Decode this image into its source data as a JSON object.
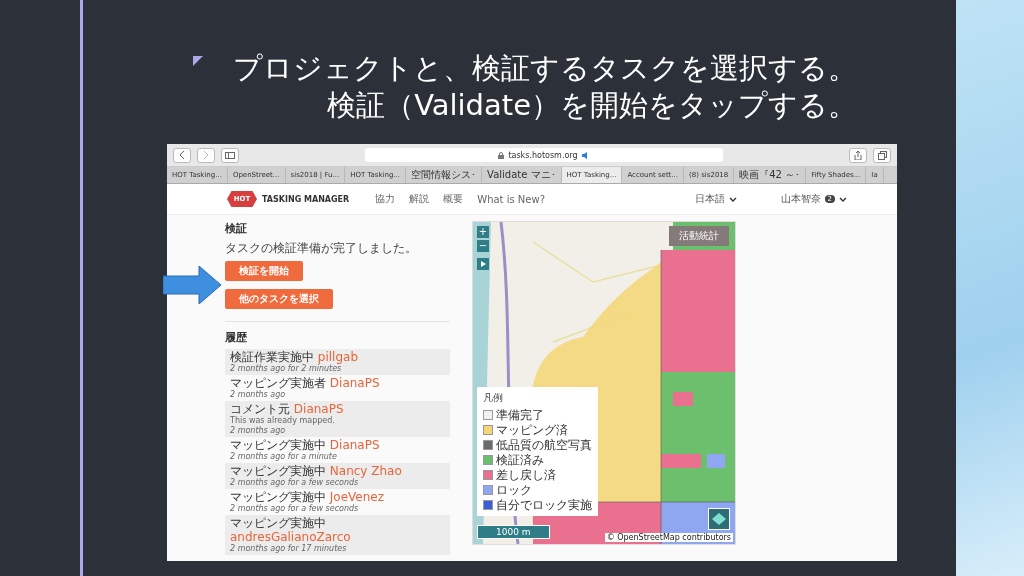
{
  "slide": {
    "title_lines": [
      "プロジェクトと、検証するタスクを選択する。",
      "検証（Validate）を開始をタップする。"
    ]
  },
  "browser": {
    "address": "tasks.hotosm.org",
    "tabs": [
      {
        "label": "HOT Tasking...",
        "selected": false
      },
      {
        "label": "OpenStreet...",
        "selected": false
      },
      {
        "label": "sis2018 | Fu...",
        "selected": false
      },
      {
        "label": "HOT Tasking...",
        "selected": false
      },
      {
        "label": "空間情報シス･",
        "selected": false
      },
      {
        "label": "Validate マニ･",
        "selected": false
      },
      {
        "label": "HOT Tasking...",
        "selected": true
      },
      {
        "label": "Account sett...",
        "selected": false
      },
      {
        "label": "(8) sis2018",
        "selected": false
      },
      {
        "label": "映画『42 ～･",
        "selected": false
      },
      {
        "label": "Fifty Shades...",
        "selected": false
      },
      {
        "label": "Ia",
        "selected": false
      }
    ]
  },
  "site_header": {
    "logo_text": "HOT",
    "brand": "TASKING MANAGER",
    "nav": [
      "協力",
      "解説",
      "概要",
      "What is New?"
    ],
    "language": "日本語",
    "user": "山本智奈",
    "user_badge": "2"
  },
  "task_panel": {
    "heading": "検証",
    "message": "タスクの検証準備が完了しました。",
    "buttons": [
      "検証を開始",
      "他のタスクを選択"
    ]
  },
  "history": {
    "heading": "履歴",
    "entries": [
      {
        "action": "検証作業実施中",
        "user": "pillgab",
        "time": "2 months ago for 2 minutes"
      },
      {
        "action": "マッピング実施者",
        "user": "DianaPS",
        "time": "2 months ago"
      },
      {
        "action": "コメント元",
        "user": "DianaPS",
        "comment": "This was already mapped.",
        "time": "2 months ago"
      },
      {
        "action": "マッピング実施中",
        "user": "DianaPS",
        "time": "2 months ago for a minute"
      },
      {
        "action": "マッピング実施中",
        "user": "Nancy Zhao",
        "time": "2 months ago for a few seconds"
      },
      {
        "action": "マッピング実施中",
        "user": "JoeVenez",
        "time": "2 months ago for a few seconds"
      },
      {
        "action": "マッピング実施中",
        "user": "andresGalianoZarco",
        "time": "2 months ago for 17 minutes"
      }
    ]
  },
  "map": {
    "stats_button": "活動統計",
    "zoom_in": "+",
    "zoom_out": "−",
    "legend": {
      "title": "凡例",
      "items": [
        {
          "label": "準備完了",
          "color": "#eef2f4"
        },
        {
          "label": "マッピング済",
          "color": "#f5d77a"
        },
        {
          "label": "低品質の航空写真",
          "color": "#6b6b6b"
        },
        {
          "label": "検証済み",
          "color": "#6cbf6c"
        },
        {
          "label": "差し戻し済",
          "color": "#e9708e"
        },
        {
          "label": "ロック",
          "color": "#8fa6f0"
        },
        {
          "label": "自分でロック実施",
          "color": "#3b5fd6"
        }
      ]
    },
    "scale": "1000 m",
    "attribution": "© OpenStreetMap contributors"
  }
}
